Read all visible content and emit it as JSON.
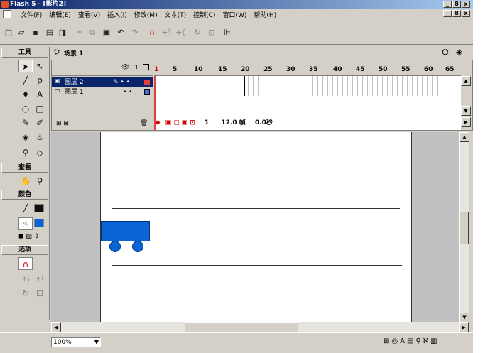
{
  "window": {
    "title": "Flash 5 - [影片2]"
  },
  "menu": [
    "文件(F)",
    "编辑(E)",
    "查看(V)",
    "插入(I)",
    "修改(M)",
    "文本(T)",
    "控制(C)",
    "窗口(W)",
    "帮助(H)"
  ],
  "window_controls": {
    "minimize": "_",
    "restore": "8",
    "close": "x"
  },
  "toolbar_icons": [
    "new-icon",
    "open-icon",
    "save-icon",
    "print-icon",
    "print-preview-icon",
    "cut-icon",
    "copy-icon",
    "paste-icon",
    "undo-icon",
    "redo-icon",
    "snap-icon",
    "smooth-icon",
    "straighten-icon",
    "rotate-icon",
    "scale-icon",
    "align-icon"
  ],
  "tools_panel": {
    "title": "工具",
    "view_title": "查看",
    "colors_title": "颜色",
    "options_title": "选项"
  },
  "scene": {
    "label": "场景 1"
  },
  "timeline": {
    "frame_numbers": [
      "5",
      "10",
      "15",
      "20",
      "25",
      "30",
      "35",
      "40",
      "45",
      "50",
      "55",
      "60",
      "65"
    ],
    "current_frame": "1",
    "frame_rate": "12.0 帧",
    "elapsed": "0.0秒",
    "layers": [
      {
        "name": "图层 2",
        "active": true
      },
      {
        "name": "图层 1",
        "active": false
      }
    ]
  },
  "status": {
    "zoom": "100%"
  },
  "colors": {
    "title_start": "#0a246a",
    "title_end": "#a6caf0",
    "shape_blue": "#0a64d6",
    "active_layer": "#0a246a"
  }
}
